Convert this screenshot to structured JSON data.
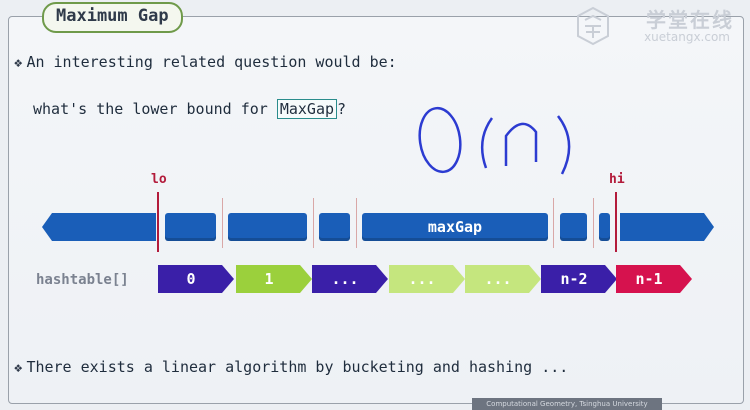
{
  "slide": {
    "title": "Maximum Gap",
    "bullet1": "An interesting related question would be:",
    "line2_prefix": "what's the lower bound for",
    "line2_boxed": "MaxGap",
    "line2_suffix": "?",
    "handwritten_note": "O(n)",
    "label_lo": "lo",
    "label_hi": "hi",
    "max_gap_label": "maxGap",
    "hashtable_label": "hashtable[]",
    "buckets": [
      {
        "label": "0",
        "color": "#3a1fa8"
      },
      {
        "label": "1",
        "color": "#9bd03c"
      },
      {
        "label": "...",
        "color": "#3a1fa8"
      },
      {
        "label": "...",
        "color": "#c5e67e"
      },
      {
        "label": "...",
        "color": "#c5e67e"
      },
      {
        "label": "n-2",
        "color": "#3a1fa8"
      },
      {
        "label": "n-1",
        "color": "#d6124e"
      }
    ],
    "bullet2": "There exists a linear algorithm by bucketing and hashing ...",
    "footer": "Computational Geometry, Tsinghua University"
  },
  "watermark": {
    "cn": "学堂在线",
    "en": "xuetangx.com"
  },
  "colors": {
    "accent_blue": "#1a5eb8",
    "bound_red": "#b31b3b",
    "title_border": "#6f9a4a"
  }
}
